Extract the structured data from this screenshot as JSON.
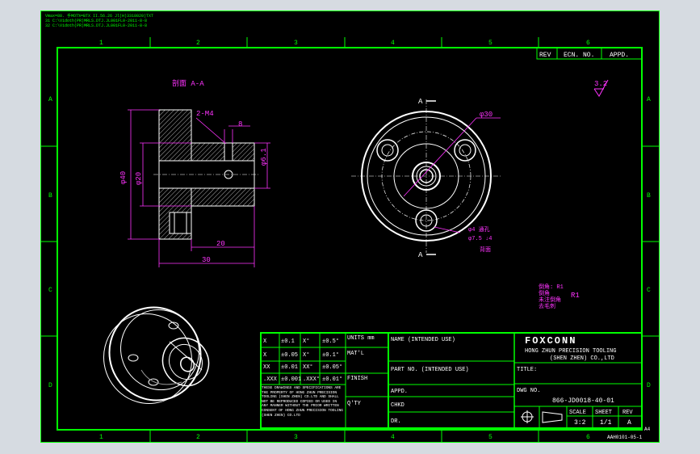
{
  "header_notes": [
    "Vmax=88. 手MOT%=BTX II.56.26 Jl(H)3318020)TXT",
    "31 C:\\Vidoth(PR)MRLS.DTJ.JL001FL0-2011-8-8",
    "32 C:\\Vidoth(PR)MRLS.DTJ.JL001FL0-2011-8-8"
  ],
  "border": {
    "columns": [
      "1",
      "2",
      "3",
      "4",
      "5",
      "6"
    ],
    "rows": [
      "A",
      "B",
      "C",
      "D"
    ]
  },
  "revision_block": {
    "rev": "REV",
    "ecn_no": "ECN. NO.",
    "appd": "APPD."
  },
  "surface_finish": "3.2",
  "section_view": {
    "title": "剖面 A-A",
    "thread_callout": "2-M4",
    "dim_8": "8",
    "dim_dia40": "φ40",
    "dim_dia20": "φ20",
    "dim_dia61": "φ6.1",
    "dim_20": "20",
    "dim_30": "30"
  },
  "front_view": {
    "section_mark": "A",
    "pcd_label": "φ30",
    "hole_note_1": "φ4 通孔",
    "hole_note_2": "φ7.5 ↓4",
    "hole_note_3": "背面"
  },
  "notes": [
    "倒角: R1",
    "倒角",
    "未注倒角",
    "去毛刺"
  ],
  "notes_r1": "R1",
  "tolerances": {
    "rows": [
      [
        "X",
        "±0.1",
        "X°",
        "±0.5°"
      ],
      [
        "X",
        "±0.05",
        "X°",
        "±0.1°"
      ],
      [
        "XX",
        "±0.01",
        "XX°",
        "±0.05°"
      ],
      [
        ".XXX",
        "±0.001",
        ".XXX°",
        "±0.01°"
      ]
    ],
    "units": "UNITS mm",
    "matl": "MAT'L",
    "finish": "FINISH",
    "qty": "Q'TY",
    "disclaimer": "THESE DRAWINGS AND SPECIFICATIONS ARE THE PROPERTY OF HONG ZHUN PRECISION TOOLING (SHEN ZHEN) CO.LTD AND SHALL NOT BE REPRODUCED COPIED OR USED IN ANY MANNER WITHOUT THE PRIOR WRITTEN CONSENT OF HONG ZHUN PRECISION TOOLING (SHEN ZHEN) CO.LTD"
  },
  "title_block": {
    "name": "NAME (INTENDED USE)",
    "part_no": "PART NO. (INTENDED USE)",
    "appd": "APPD.",
    "chkd": "CHKD",
    "dr": "DR.",
    "brand": "FOXCONN",
    "company_line1": "HONG ZHUN PRECISION TOOLING",
    "company_line2": "(SHEN ZHEN) CO.,LTD",
    "title_label": "TITLE:",
    "dwg_no_label": "DWG NO.",
    "dwg_no": "866-JD0018-40-01",
    "scale_label": "SCALE",
    "scale": "3:2",
    "sheet_label": "SHEET",
    "sheet": "1/1",
    "rev_label": "REV",
    "rev": "A",
    "size": "A4",
    "form_no": "AAH0101-05-1"
  }
}
